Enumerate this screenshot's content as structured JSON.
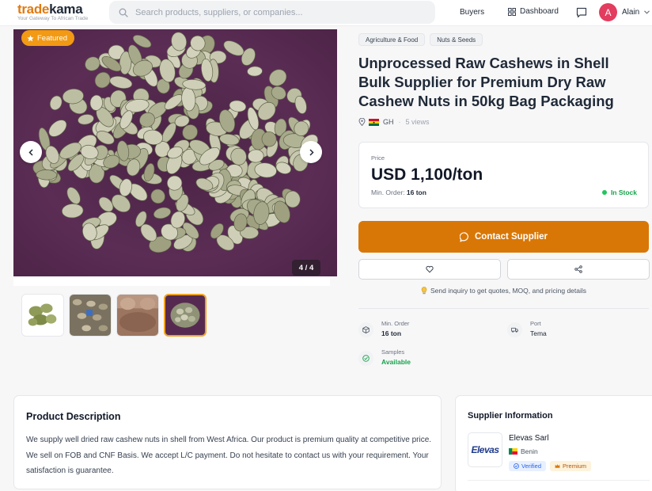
{
  "header": {
    "logo_trade": "trade",
    "logo_kama": "kama",
    "logo_tagline": "Your Gateway To African Trade",
    "search_placeholder": "Search products, suppliers, or companies...",
    "nav_buyers": "Buyers",
    "nav_dashboard": "Dashboard",
    "user_initial": "A",
    "user_name": "Alain"
  },
  "gallery": {
    "featured_label": "Featured",
    "counter": "4 / 4",
    "thumbnail_count": 4,
    "active_thumbnail": 4
  },
  "product": {
    "tags": [
      "Agriculture & Food",
      "Nuts & Seeds"
    ],
    "title": "Unprocessed Raw Cashews in Shell Bulk Supplier for Premium Dry Raw Cashew Nuts in 50kg Bag Packaging",
    "country_code": "GH",
    "views": "5 views",
    "price_label": "Price",
    "price": "USD 1,100/ton",
    "min_order_label": "Min. Order:",
    "min_order_value": "16 ton",
    "stock_status": "In Stock",
    "contact_label": "Contact Supplier",
    "hint": "Send inquiry to get quotes, MOQ, and pricing details",
    "specs": {
      "min_order_label": "Min. Order",
      "min_order_value": "16 ton",
      "port_label": "Port",
      "port_value": "Tema",
      "samples_label": "Samples",
      "samples_value": "Available"
    }
  },
  "description": {
    "title": "Product Description",
    "text": "We supply well dried raw cashew nuts in shell from West Africa. Our product is premium quality at competitive price. We sell on FOB and CNF Basis. We accept L/C payment. Do not hesitate to contact us with your requirement. Your satisfaction is guarantee."
  },
  "supplier": {
    "section_title": "Supplier Information",
    "logo_text": "Elevas",
    "name": "Elevas Sarl",
    "country": "Benin",
    "badge_verified": "Verified",
    "badge_premium": "Premium"
  },
  "colors": {
    "accent_orange": "#d97706",
    "featured_orange": "#f29a14",
    "stock_green": "#16a34a",
    "avatar_pink": "#e23c5e",
    "photo_background": "#5b2d55"
  }
}
